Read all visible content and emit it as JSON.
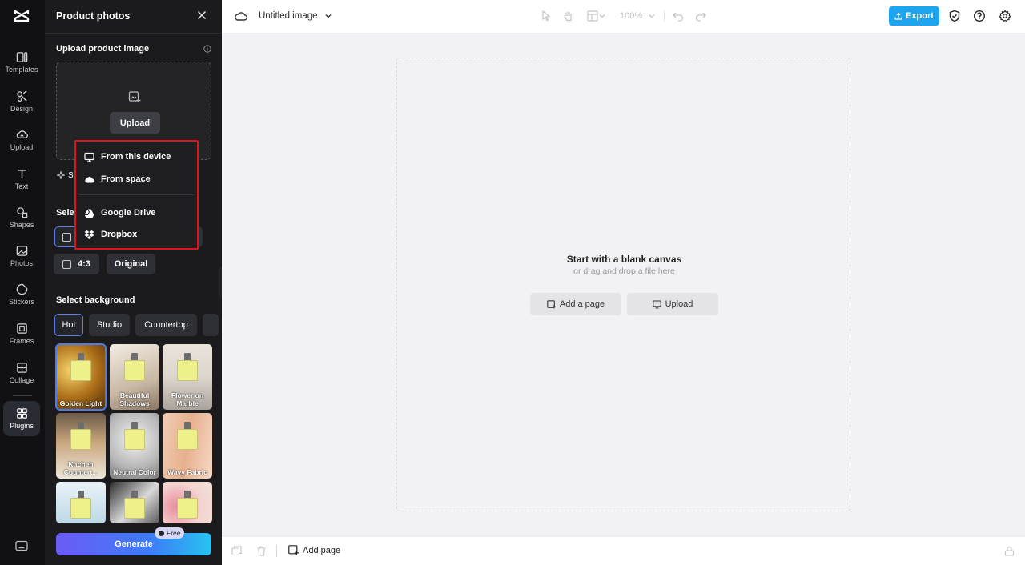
{
  "rail": {
    "items": [
      {
        "label": "Templates",
        "icon": "templates-icon"
      },
      {
        "label": "Design",
        "icon": "design-icon"
      },
      {
        "label": "Upload",
        "icon": "upload-cloud-icon"
      },
      {
        "label": "Text",
        "icon": "text-icon"
      },
      {
        "label": "Shapes",
        "icon": "shapes-icon"
      },
      {
        "label": "Photos",
        "icon": "photos-icon"
      },
      {
        "label": "Stickers",
        "icon": "stickers-icon"
      },
      {
        "label": "Frames",
        "icon": "frames-icon"
      },
      {
        "label": "Collage",
        "icon": "collage-icon"
      },
      {
        "label": "Plugins",
        "icon": "plugins-icon"
      }
    ],
    "active": "Plugins"
  },
  "panel": {
    "title": "Product photos",
    "upload_section_title": "Upload product image",
    "upload_button": "Upload",
    "partial_s": "S",
    "partial_select": "Sele",
    "ratio": {
      "r43": "4:3",
      "original": "Original"
    },
    "background_title": "Select background",
    "tabs": [
      "Hot",
      "Studio",
      "Countertop"
    ],
    "active_tab": "Hot",
    "thumbnails": [
      {
        "caption": "Golden Light"
      },
      {
        "caption": "Beautiful Shadows"
      },
      {
        "caption": "Flower on Marble"
      },
      {
        "caption": "Kitchen Countert..."
      },
      {
        "caption": "Neutral Color"
      },
      {
        "caption": "Wavy Fabric"
      },
      {
        "caption": ""
      },
      {
        "caption": ""
      },
      {
        "caption": ""
      }
    ],
    "selected_thumbnail": "Golden Light",
    "generate_button": "Generate",
    "free_badge": "Free"
  },
  "upload_menu": {
    "items": [
      {
        "label": "From this device",
        "icon": "monitor-icon"
      },
      {
        "label": "From space",
        "icon": "cloud-icon"
      },
      {
        "label": "Google Drive",
        "icon": "google-drive-icon"
      },
      {
        "label": "Dropbox",
        "icon": "dropbox-icon"
      }
    ]
  },
  "topbar": {
    "doc_title": "Untitled image",
    "zoom": "100%",
    "export": "Export"
  },
  "canvas": {
    "title": "Start with a blank canvas",
    "subtitle": "or drag and drop a file here",
    "add_page": "Add a page",
    "upload": "Upload"
  },
  "bottombar": {
    "add_page": "Add page"
  },
  "colors": {
    "accent": "#1fa4f0",
    "menu_highlight_border": "#e3111e",
    "selection_blue": "#4a7bf0"
  }
}
